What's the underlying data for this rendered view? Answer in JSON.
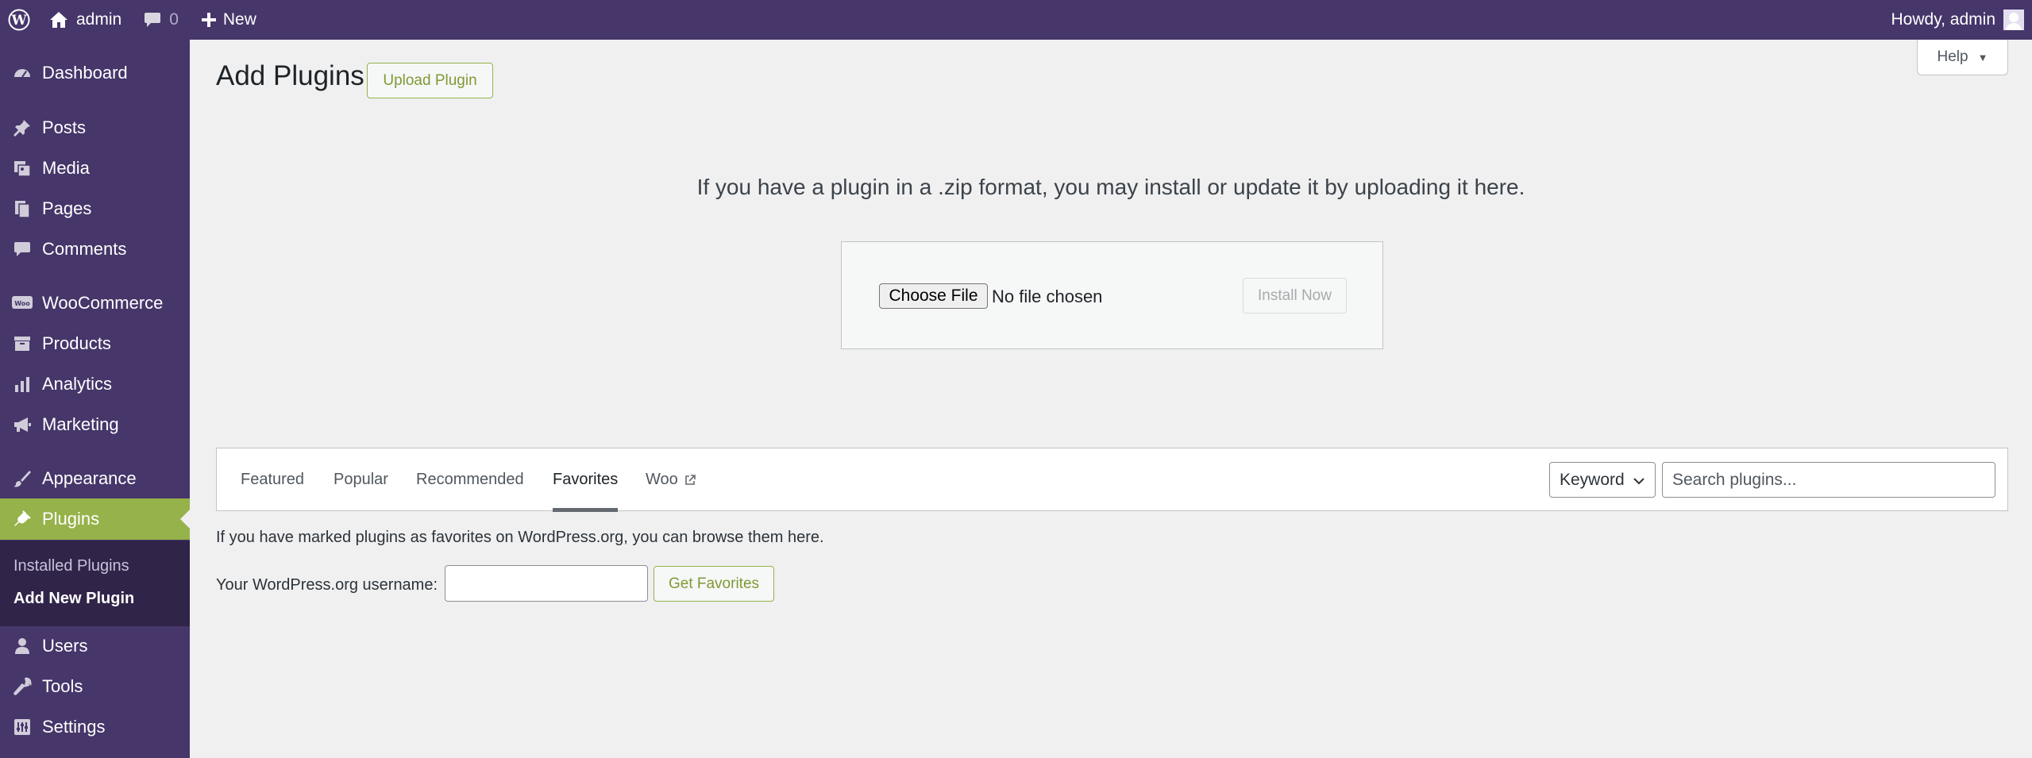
{
  "adminbar": {
    "site_name": "admin",
    "comments_count": "0",
    "new_label": "New",
    "howdy": "Howdy, admin"
  },
  "sidebar": {
    "items": [
      {
        "label": "Dashboard",
        "icon": "dashboard-icon"
      },
      {
        "label": "Posts",
        "icon": "pin-icon"
      },
      {
        "label": "Media",
        "icon": "media-icon"
      },
      {
        "label": "Pages",
        "icon": "pages-icon"
      },
      {
        "label": "Comments",
        "icon": "comment-icon"
      },
      {
        "label": "WooCommerce",
        "icon": "woo-icon"
      },
      {
        "label": "Products",
        "icon": "archive-icon"
      },
      {
        "label": "Analytics",
        "icon": "bar-chart-icon"
      },
      {
        "label": "Marketing",
        "icon": "megaphone-icon"
      },
      {
        "label": "Appearance",
        "icon": "brush-icon"
      },
      {
        "label": "Plugins",
        "icon": "plug-icon"
      },
      {
        "label": "Users",
        "icon": "user-icon"
      },
      {
        "label": "Tools",
        "icon": "wrench-icon"
      },
      {
        "label": "Settings",
        "icon": "settings-icon"
      }
    ],
    "submenu": [
      {
        "label": "Installed Plugins"
      },
      {
        "label": "Add New Plugin"
      }
    ],
    "active_color": "#96b24a",
    "background": "#46366a"
  },
  "header": {
    "title": "Add Plugins",
    "upload_button": "Upload Plugin",
    "help": "Help"
  },
  "upload": {
    "help_text": "If you have a plugin in a .zip format, you may install or update it by uploading it here.",
    "choose_file": "Choose File",
    "no_file": "No file chosen",
    "install_now": "Install Now"
  },
  "tabs": [
    {
      "label": "Featured"
    },
    {
      "label": "Popular"
    },
    {
      "label": "Recommended"
    },
    {
      "label": "Favorites"
    },
    {
      "label": "Woo"
    }
  ],
  "search": {
    "type_selected": "Keyword",
    "placeholder": "Search plugins..."
  },
  "favorites": {
    "description": "If you have marked plugins as favorites on WordPress.org, you can browse them here.",
    "username_label": "Your WordPress.org username:",
    "username_value": "",
    "button": "Get Favorites"
  }
}
